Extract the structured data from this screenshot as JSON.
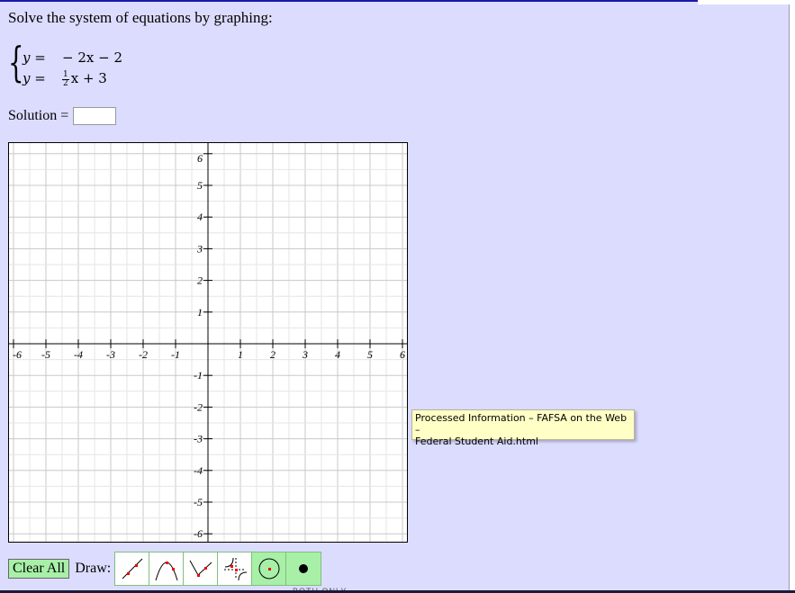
{
  "prompt": "Solve the system of equations by graphing:",
  "equations": {
    "eq1": {
      "lhs": "y =",
      "rhs": "− 2x − 2"
    },
    "eq2": {
      "lhs": "y =",
      "frac_num": "1",
      "frac_den": "2",
      "rhs_rest": "x + 3"
    }
  },
  "solution": {
    "label": "Solution =",
    "value": "",
    "placeholder": ""
  },
  "graph": {
    "x_ticks": [
      "-6",
      "-5",
      "-4",
      "-3",
      "-2",
      "-1",
      "1",
      "2",
      "3",
      "4",
      "5",
      "6"
    ],
    "y_ticks": [
      "6",
      "5",
      "4",
      "3",
      "2",
      "1",
      "-1",
      "-2",
      "-3",
      "-4",
      "-5",
      "-6"
    ],
    "xmin": -6,
    "xmax": 6,
    "ymin": -6,
    "ymax": 6
  },
  "tooltip": {
    "line1": "Processed Information – FAFSA on the Web –",
    "line2": "Federal Student Aid.html"
  },
  "toolbar": {
    "clear_label": "Clear All",
    "draw_label": "Draw:",
    "tools": [
      "line-tool",
      "parabola-tool",
      "absolute-value-tool",
      "hyperbola-tool",
      "circle-tool",
      "point-tool"
    ]
  },
  "colors": {
    "background": "#dcdcff",
    "tool_green": "#a8f0a8",
    "tooltip_bg": "#ffffc6"
  },
  "footer_partial": "BOTH ONLY"
}
